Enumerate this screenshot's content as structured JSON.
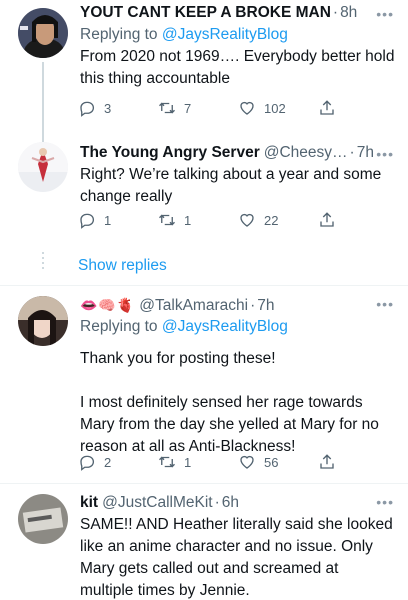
{
  "tweets": [
    {
      "name": "YOUT CANT KEEP A BROKE MAN",
      "handle": "",
      "time": "8h",
      "reply_prefix": "Replying to ",
      "reply_to": "@JaysRealityBlog",
      "text": [
        "From 2020 not 1969…. Everybody better hold this thing accountable"
      ],
      "replies": "3",
      "retweets": "7",
      "likes": "102"
    },
    {
      "name": "The Young Angry Server",
      "handle": "@Cheesy…",
      "time": "7h",
      "text": [
        "Right? We’re talking about a year and some change really"
      ],
      "replies": "1",
      "retweets": "1",
      "likes": "22"
    },
    {
      "name_emoji": "👄🧠🫀",
      "handle": "@TalkAmarachi",
      "time": "7h",
      "reply_prefix": "Replying to ",
      "reply_to": "@JaysRealityBlog",
      "text": [
        "Thank you for posting these!",
        "I most definitely sensed her rage towards Mary from the day she yelled at Mary for no reason at all as Anti-Blackness!"
      ],
      "replies": "2",
      "retweets": "1",
      "likes": "56"
    },
    {
      "name": "kit",
      "handle": "@JustCallMeKit",
      "time": "6h",
      "text": [
        "SAME!! AND Heather literally said she looked like an anime character and no issue. Only Mary gets called out and screamed at multiple times by Jennie."
      ]
    }
  ],
  "show_replies": "Show replies",
  "more_label": "•••",
  "separator": "·"
}
